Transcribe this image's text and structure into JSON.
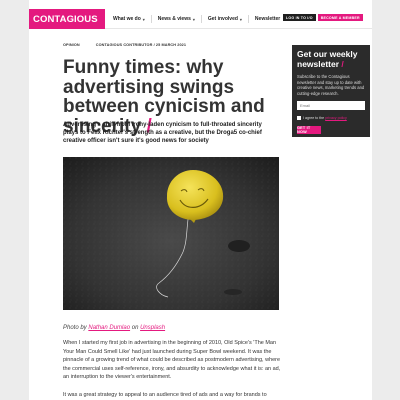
{
  "header": {
    "logo": "CONTAGIOUS",
    "nav": [
      {
        "label": "What we do",
        "caret": "▾"
      },
      {
        "label": "News & views",
        "caret": "▾"
      },
      {
        "label": "Get involved",
        "caret": "▾"
      },
      {
        "label": "Newsletter",
        "caret": ""
      }
    ],
    "login_label": "LOG IN TO I/O",
    "member_label": "BECOME A MEMBER"
  },
  "article": {
    "category": "OPINION",
    "byline": "CONTAGIOUS CONTRIBUTOR / 25 MARCH 2021",
    "title": "Funny times: why advertising swings between cynicism and sincerity",
    "title_slash": "/",
    "standfirst": "Advertising's shift from irony-laden cynicism to full-throated sincerity plays to Felix Richter's strength as a creative, but the Droga5 co-chief creative officer isn't sure it's good news for society",
    "photo_alt": "deflated yellow smiley balloon on asphalt",
    "credit": {
      "prefix": "Photo by ",
      "author": "Nathan Dumlao",
      "on": " on ",
      "site": "Unsplash"
    },
    "paragraphs": [
      "When I started my first job in advertising in the beginning of 2010, Old Spice's 'The Man Your Man Could Smell Like' had just launched during Super Bowl weekend. It was the pinnacle of a growing trend of what could be described as postmodern advertising, where the commercial uses self-reference, irony, and absurdity to acknowledge what it is: an ad, an interruption to the viewer's entertainment.",
      "It was a great strategy to appeal to an audience tired of ads and a way for brands to"
    ]
  },
  "signup": {
    "heading": "Get our weekly newsletter",
    "slash": "/",
    "description": "Subscribe to the Contagious newsletter and stay up to date with creative news, marketing trends and cutting-edge research.",
    "email_placeholder": "Email",
    "agree_text": "I agree to the",
    "privacy_link": "privacy policy",
    "submit_label": "GET IT NOW"
  },
  "colors": {
    "accent": "#e4197f",
    "dark": "#2b2b2b"
  }
}
